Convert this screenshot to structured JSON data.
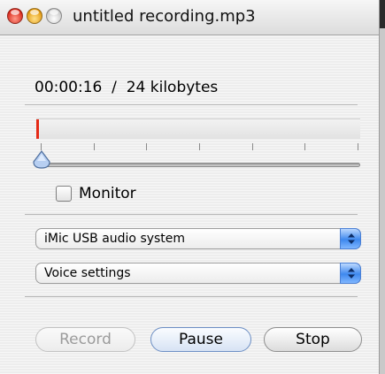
{
  "window": {
    "title": "untitled recording.mp3"
  },
  "status": {
    "time": "00:00:16",
    "divider": "/",
    "size": "24 kilobytes"
  },
  "level_meter": {
    "current_level": 0.008
  },
  "gain_slider": {
    "value": 0.0,
    "tick_count": 7
  },
  "monitor": {
    "label": "Monitor",
    "checked": false
  },
  "input_device": {
    "selected": "iMic USB audio system"
  },
  "settings": {
    "selected": "Voice settings"
  },
  "buttons": {
    "record": "Record",
    "pause": "Pause",
    "stop": "Stop"
  },
  "colors": {
    "level": "#e52a16",
    "popup_accent": "#3e88ee",
    "disabled_text": "#9b9b9b"
  }
}
